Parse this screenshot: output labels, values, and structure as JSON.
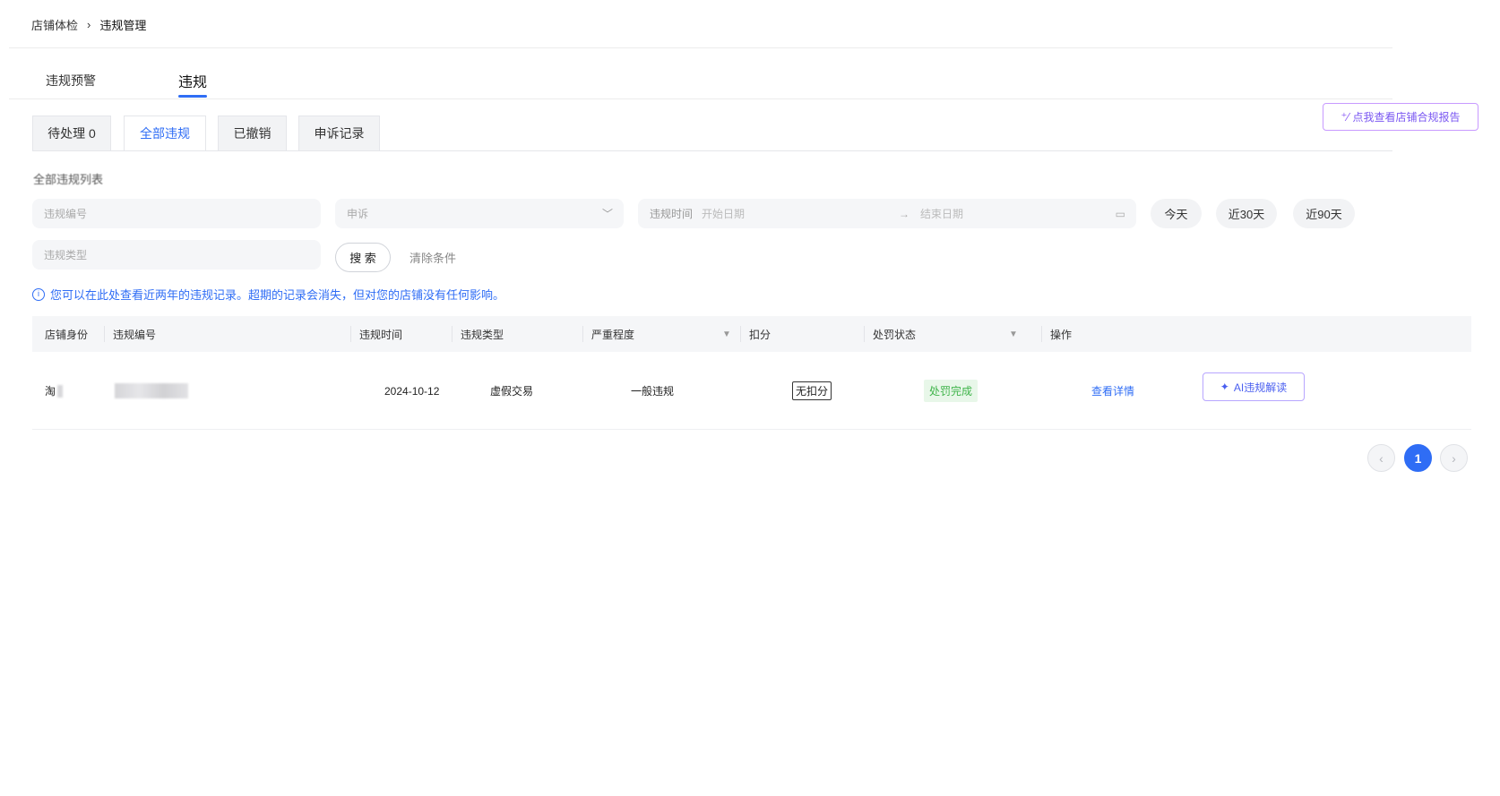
{
  "breadcrumb": {
    "items": [
      "店铺体检",
      "违规管理"
    ],
    "separator": "›"
  },
  "main_tabs": [
    "违规预警",
    "违规"
  ],
  "report_button": {
    "icon": "sparkle-icon",
    "label": "点我查看店铺合规报告"
  },
  "sub_tabs": [
    "待处理 0",
    "全部违规",
    "已撤销",
    "申诉记录"
  ],
  "section_title": "全部违规列表",
  "filters": {
    "code_placeholder": "违规编号",
    "appeal_placeholder": "申诉",
    "date_label": "违规时间",
    "start_placeholder": "开始日期",
    "end_placeholder": "结束日期",
    "range_arrow": "→",
    "quick_ranges": [
      "今天",
      "近30天",
      "近90天"
    ],
    "type_placeholder": "违规类型",
    "search_label": "搜 索",
    "clear_label": "清除条件"
  },
  "notice": "您可以在此处查看近两年的违规记录。超期的记录会消失，但对您的店铺没有任何影响。",
  "table": {
    "columns": [
      "店铺身份",
      "违规编号",
      "违规时间",
      "违规类型",
      "严重程度",
      "扣分",
      "处罚状态",
      "操作"
    ],
    "rows": [
      {
        "shop": "淘",
        "date": "2024-10-12",
        "type": "虚假交易",
        "severity": "一般违规",
        "score": "无扣分",
        "status": "处罚完成",
        "detail_label": "查看详情",
        "ai_label": "AI违规解读"
      }
    ]
  },
  "pagination": {
    "current": "1",
    "prev": "‹",
    "next": "›"
  },
  "colors": {
    "accent": "#2f6df5",
    "success_text": "#3fb44a",
    "success_bg": "#e8f7e9",
    "ai_purple": "#8c5cf5"
  }
}
